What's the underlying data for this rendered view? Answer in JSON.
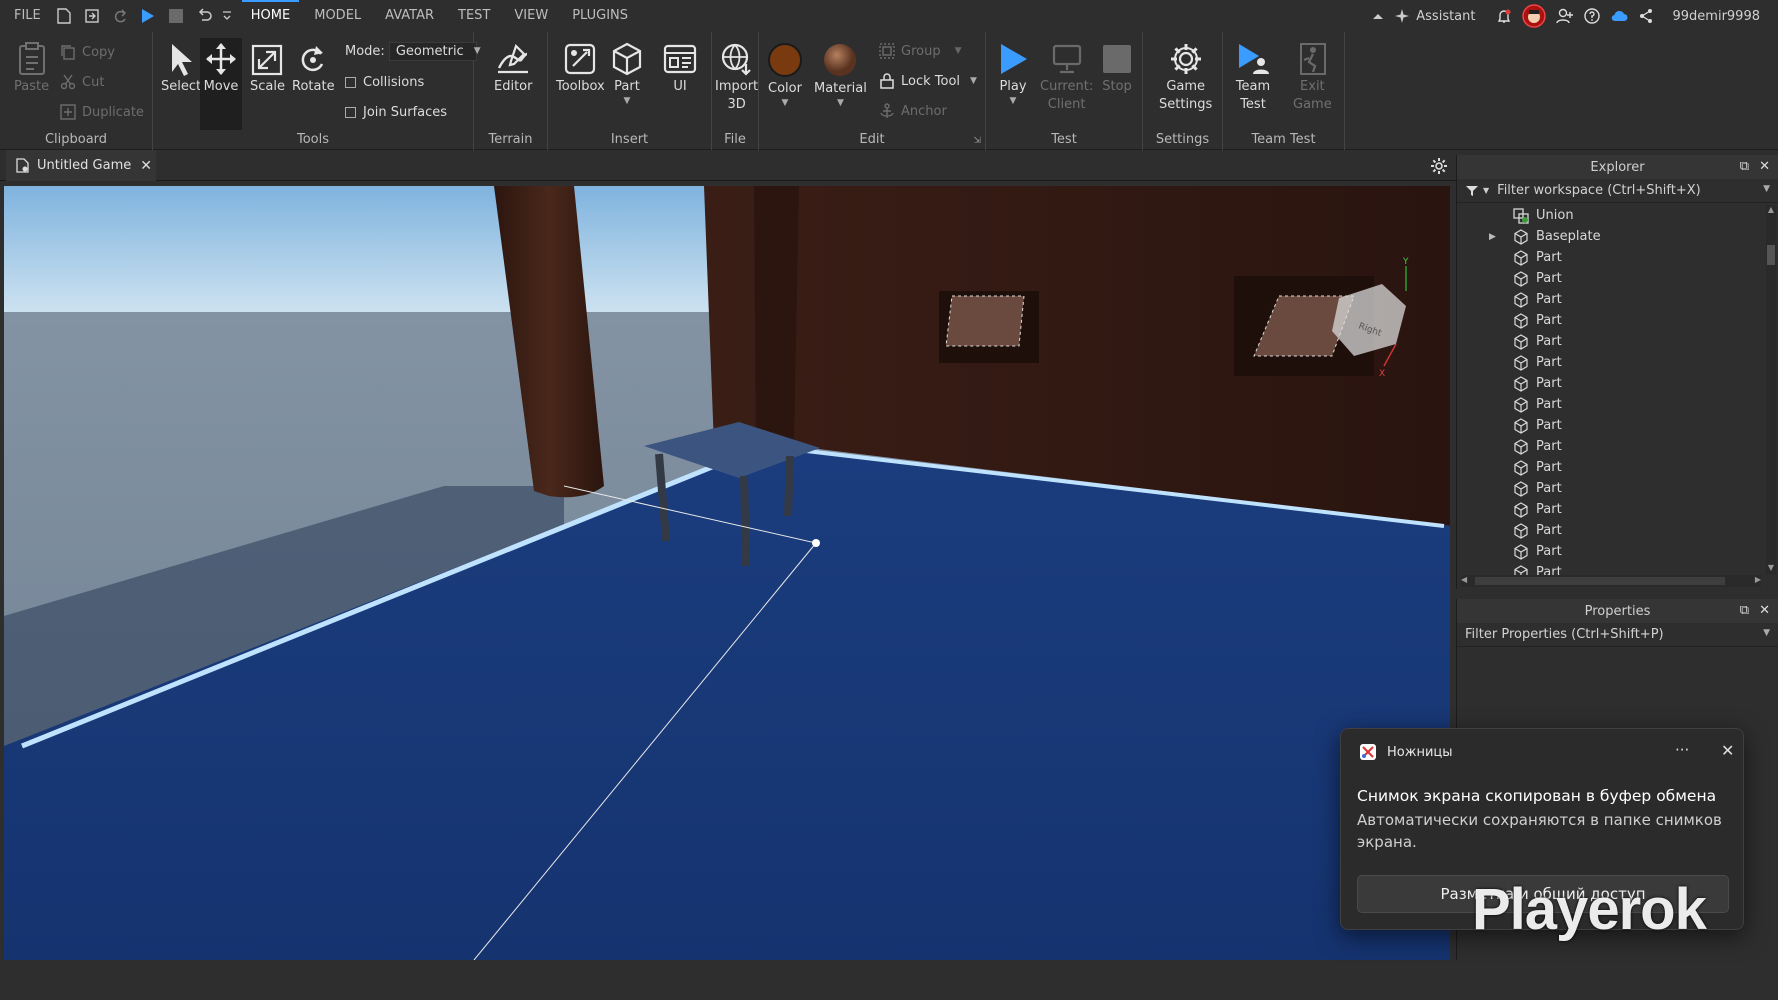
{
  "menubar": {
    "tabs": [
      "FILE",
      "HOME",
      "MODEL",
      "AVATAR",
      "TEST",
      "VIEW",
      "PLUGINS"
    ],
    "active_tab": "HOME",
    "assistant_label": "Assistant",
    "username": "99demir9998"
  },
  "ribbon": {
    "clipboard": {
      "group_label": "Clipboard",
      "paste": "Paste",
      "copy": "Copy",
      "cut": "Cut",
      "duplicate": "Duplicate"
    },
    "tools": {
      "group_label": "Tools",
      "select": "Select",
      "move": "Move",
      "scale": "Scale",
      "rotate": "Rotate",
      "mode_label": "Mode:",
      "mode_value": "Geometric",
      "collisions": "Collisions",
      "join_surfaces": "Join Surfaces"
    },
    "terrain": {
      "group_label": "Terrain",
      "editor": "Editor"
    },
    "insert": {
      "group_label": "Insert",
      "toolbox": "Toolbox",
      "part": "Part",
      "ui": "UI"
    },
    "file": {
      "group_label": "File",
      "import_line1": "Import",
      "import_line2": "3D"
    },
    "edit": {
      "group_label": "Edit",
      "color": "Color",
      "material": "Material",
      "group": "Group",
      "lock_tool": "Lock Tool",
      "anchor": "Anchor"
    },
    "test": {
      "group_label": "Test",
      "play": "Play",
      "current_line1": "Current:",
      "current_line2": "Client",
      "stop": "Stop"
    },
    "settings": {
      "group_label": "Settings",
      "game_line1": "Game",
      "game_line2": "Settings"
    },
    "team_test": {
      "group_label": "Team Test",
      "team_line1": "Team",
      "team_line2": "Test",
      "exit_line1": "Exit",
      "exit_line2": "Game"
    },
    "colors": {
      "color_swatch": "#7a3a10",
      "material_swatch": "#8a5a3c",
      "play_blue": "#3b9cff"
    }
  },
  "document_tab": {
    "title": "Untitled Game"
  },
  "explorer": {
    "title": "Explorer",
    "filter_placeholder": "Filter workspace (Ctrl+Shift+X)",
    "items": [
      {
        "label": "Union",
        "icon": "union-icon"
      },
      {
        "label": "Baseplate",
        "icon": "part-icon",
        "expandable": true
      },
      {
        "label": "Part",
        "icon": "part-icon"
      },
      {
        "label": "Part",
        "icon": "part-icon"
      },
      {
        "label": "Part",
        "icon": "part-icon"
      },
      {
        "label": "Part",
        "icon": "part-icon"
      },
      {
        "label": "Part",
        "icon": "part-icon"
      },
      {
        "label": "Part",
        "icon": "part-icon"
      },
      {
        "label": "Part",
        "icon": "part-icon"
      },
      {
        "label": "Part",
        "icon": "part-icon"
      },
      {
        "label": "Part",
        "icon": "part-icon"
      },
      {
        "label": "Part",
        "icon": "part-icon"
      },
      {
        "label": "Part",
        "icon": "part-icon"
      },
      {
        "label": "Part",
        "icon": "part-icon"
      },
      {
        "label": "Part",
        "icon": "part-icon"
      },
      {
        "label": "Part",
        "icon": "part-icon"
      },
      {
        "label": "Part",
        "icon": "part-icon"
      },
      {
        "label": "Part",
        "icon": "part-icon"
      }
    ]
  },
  "properties": {
    "title": "Properties",
    "filter_placeholder": "Filter Properties (Ctrl+Shift+P)"
  },
  "viewport": {
    "view_cube_face": "Right",
    "axis_y": "Y",
    "axis_x": "X"
  },
  "toast": {
    "app_name": "Ножницы",
    "more": "···",
    "title": "Снимок экрана скопирован в буфер обмена",
    "body": "Автоматически сохраняются в папке снимков экрана.",
    "button": "Разметка и общий доступ"
  },
  "watermark": "Playerok"
}
